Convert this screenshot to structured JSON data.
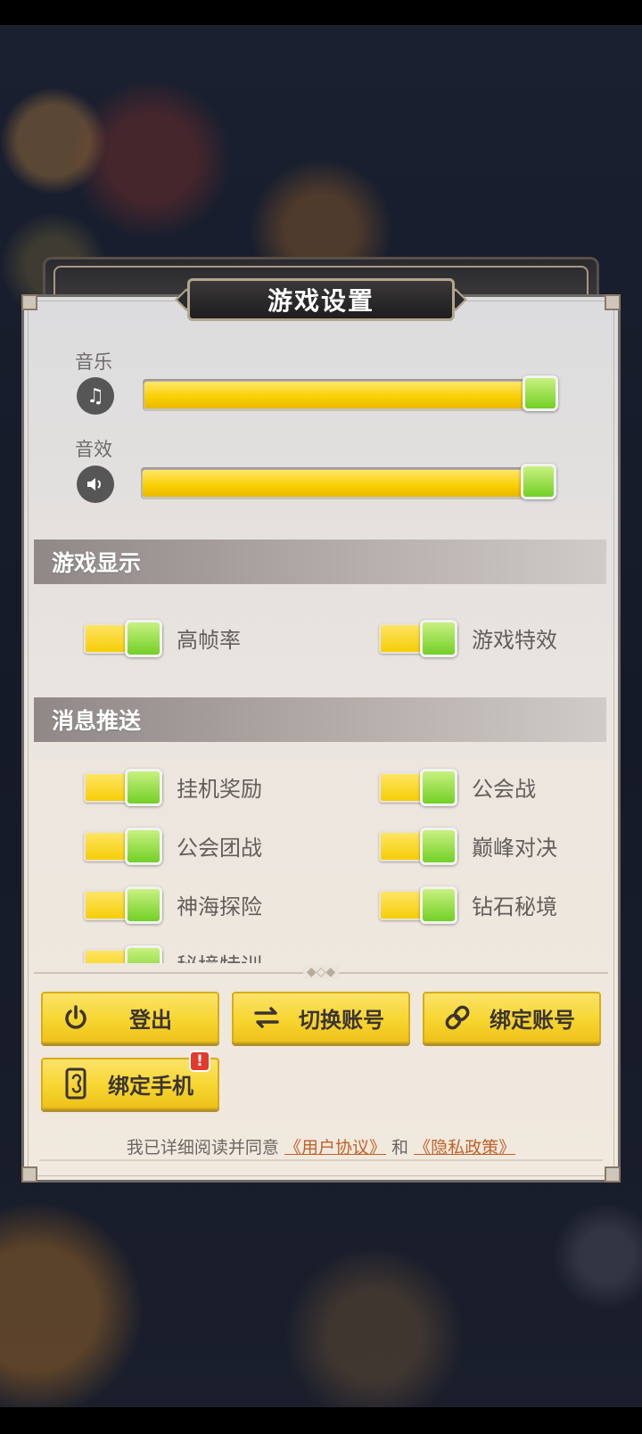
{
  "title": "游戏设置",
  "audio": [
    {
      "label": "音乐",
      "icon": "music-note-icon",
      "level": 1.0
    },
    {
      "label": "音效",
      "icon": "speaker-icon",
      "level": 1.0
    }
  ],
  "sections": {
    "display": "游戏显示",
    "push": "消息推送"
  },
  "display_toggles": [
    {
      "label": "高帧率",
      "on": true
    },
    {
      "label": "游戏特效",
      "on": true
    }
  ],
  "push_toggles": [
    {
      "label": "挂机奖励",
      "on": true
    },
    {
      "label": "公会战",
      "on": true
    },
    {
      "label": "公会团战",
      "on": true
    },
    {
      "label": "巅峰对决",
      "on": true
    },
    {
      "label": "神海探险",
      "on": true
    },
    {
      "label": "钻石秘境",
      "on": true
    },
    {
      "label": "秘境特训",
      "on": true
    }
  ],
  "buttons": {
    "logout": "登出",
    "switch_account": "切换账号",
    "bind_account": "绑定账号",
    "bind_phone": "绑定手机",
    "bind_phone_badge": "!"
  },
  "agreement": {
    "prefix": "我已详细阅读并同意",
    "user_agreement": "《用户协议》",
    "and": "和",
    "privacy_policy": "《隐私政策》"
  },
  "colors": {
    "slider_fill": "#f8cf00",
    "toggle_knob": "#72d025",
    "button": "#f7d530",
    "link": "#c0622b",
    "badge": "#e23a2c"
  }
}
